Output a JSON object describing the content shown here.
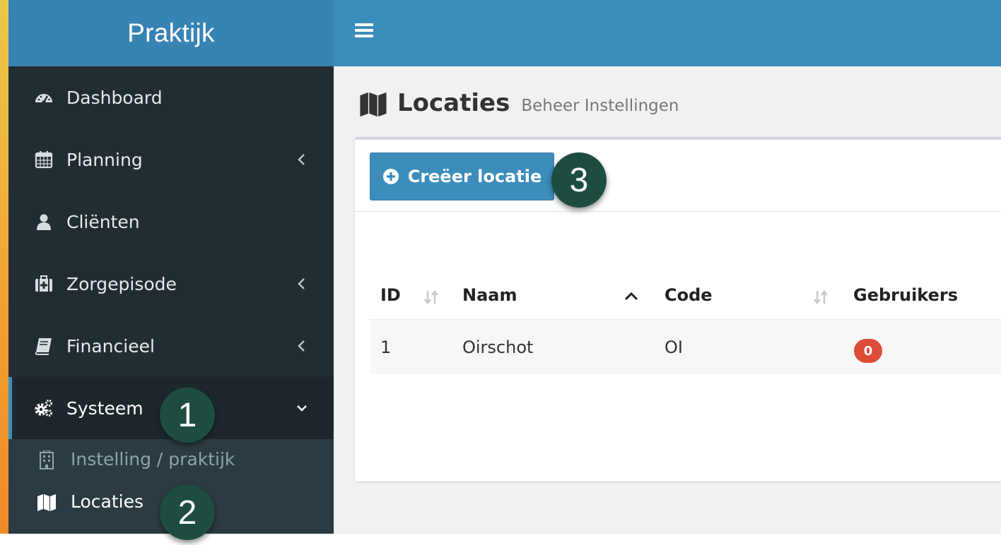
{
  "app": {
    "title": "Praktijk"
  },
  "sidebar": {
    "items": [
      {
        "label": "Dashboard",
        "icon": "dashboard-icon"
      },
      {
        "label": "Planning",
        "icon": "calendar-icon"
      },
      {
        "label": "Cliënten",
        "icon": "user-icon"
      },
      {
        "label": "Zorgepisode",
        "icon": "medkit-icon"
      },
      {
        "label": "Financieel",
        "icon": "book-icon"
      },
      {
        "label": "Systeem",
        "icon": "gears-icon"
      }
    ],
    "submenu": [
      {
        "label": "Instelling / praktijk",
        "icon": "building-icon"
      },
      {
        "label": "Locaties",
        "icon": "map-icon"
      }
    ]
  },
  "page": {
    "title": "Locaties",
    "subtitle": "Beheer Instellingen"
  },
  "toolbar": {
    "create_label": "Creëer locatie"
  },
  "table": {
    "columns": [
      "ID",
      "Naam",
      "Code",
      "Gebruikers"
    ],
    "rows": [
      {
        "id": "1",
        "naam": "Oirschot",
        "code": "OI",
        "gebruikers": "0"
      }
    ]
  },
  "markers": [
    "1",
    "2",
    "3"
  ],
  "colors": {
    "topbar": "#3c8dbc",
    "sidebar": "#222d32",
    "badge": "#dd4b39",
    "marker": "#1d4d40"
  }
}
